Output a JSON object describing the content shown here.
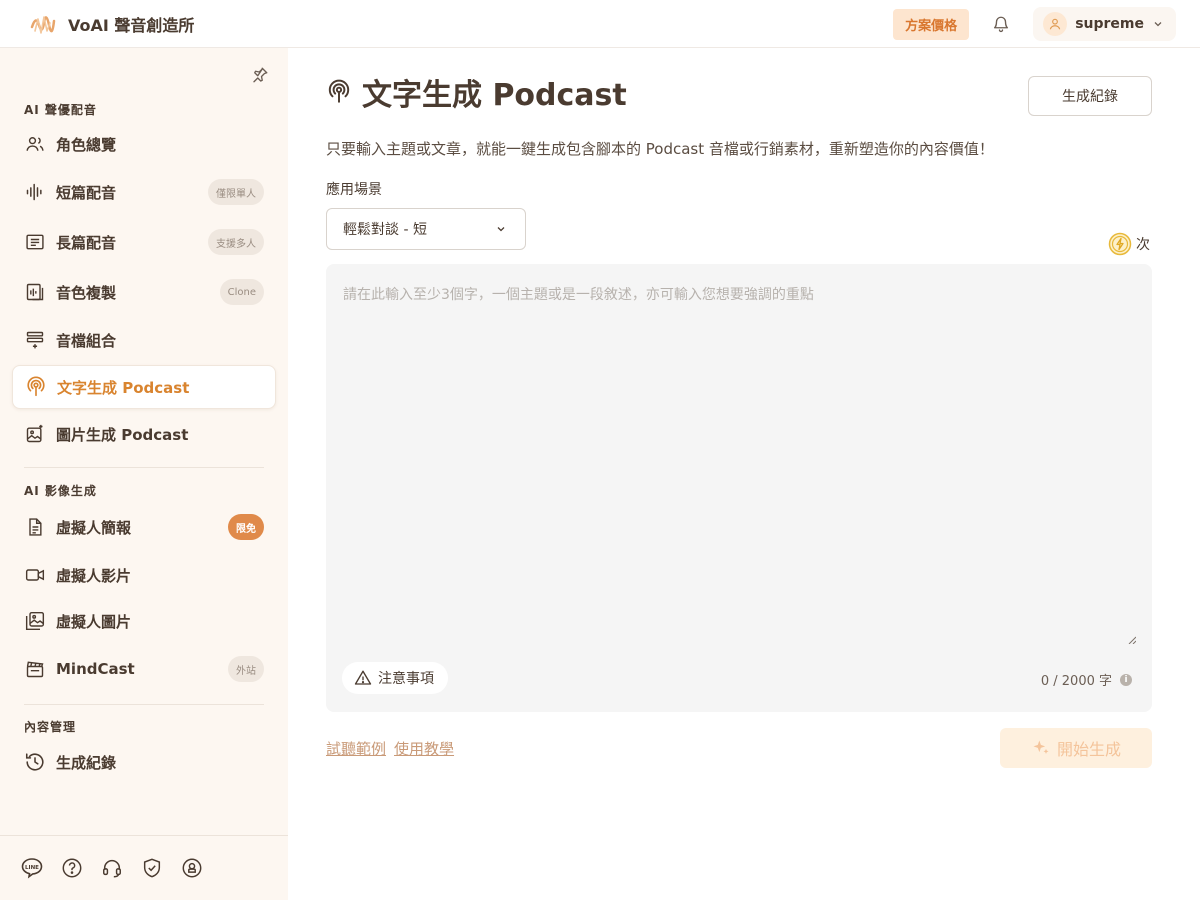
{
  "header": {
    "brand_name": "VoAI 聲音創造所",
    "pricing_label": "方案價格",
    "user_name": "supreme"
  },
  "sidebar": {
    "sections": [
      {
        "title": "AI 聲優配音"
      },
      {
        "title": "AI 影像生成"
      },
      {
        "title": "內容管理"
      }
    ],
    "items": [
      {
        "label": "角色總覽",
        "icon": "users-icon"
      },
      {
        "label": "短篇配音",
        "icon": "waveform-icon",
        "badge": "僅限單人"
      },
      {
        "label": "長篇配音",
        "icon": "list-box-icon",
        "badge": "支援多人"
      },
      {
        "label": "音色複製",
        "icon": "voice-clone-icon",
        "badge": "Clone"
      },
      {
        "label": "音檔組合",
        "icon": "layers-add-icon"
      },
      {
        "label": "文字生成 Podcast",
        "icon": "podcast-icon",
        "active": true
      },
      {
        "label": "圖片生成 Podcast",
        "icon": "image-sparkle-icon"
      },
      {
        "label": "虛擬人簡報",
        "icon": "document-icon",
        "badge": "限免"
      },
      {
        "label": "虛擬人影片",
        "icon": "video-icon"
      },
      {
        "label": "虛擬人圖片",
        "icon": "image-icon"
      },
      {
        "label": "MindCast",
        "icon": "clapperboard-icon",
        "badge": "外站"
      },
      {
        "label": "生成紀錄",
        "icon": "history-icon"
      }
    ],
    "footer_icons": [
      "line-icon",
      "help-icon",
      "headset-icon",
      "shield-check-icon",
      "privacy-icon"
    ]
  },
  "main": {
    "title": "文字生成 Podcast",
    "history_button": "生成紀錄",
    "description": "只要輸入主題或文章，就能一鍵生成包含腳本的 Podcast 音檔或行銷素材，重新塑造你的內容價值！",
    "scene_label": "應用場景",
    "scene_value": "輕鬆對談 - 短",
    "credits_unit": "次",
    "editor_placeholder": "請在此輸入至少3個字，一個主題或是一段敘述，亦可輸入您想要強調的重點",
    "notice_label": "注意事項",
    "char_count": "0 / 2000 字",
    "links": [
      "試聽範例",
      "使用教學"
    ],
    "start_button": "開始生成"
  },
  "colors": {
    "accent": "#d9842f",
    "sidebar_bg": "#fdf7f1",
    "pricing_bg": "#fde5cf",
    "start_disabled_bg": "#fef0de",
    "hot_badge": "#e08a4a"
  }
}
